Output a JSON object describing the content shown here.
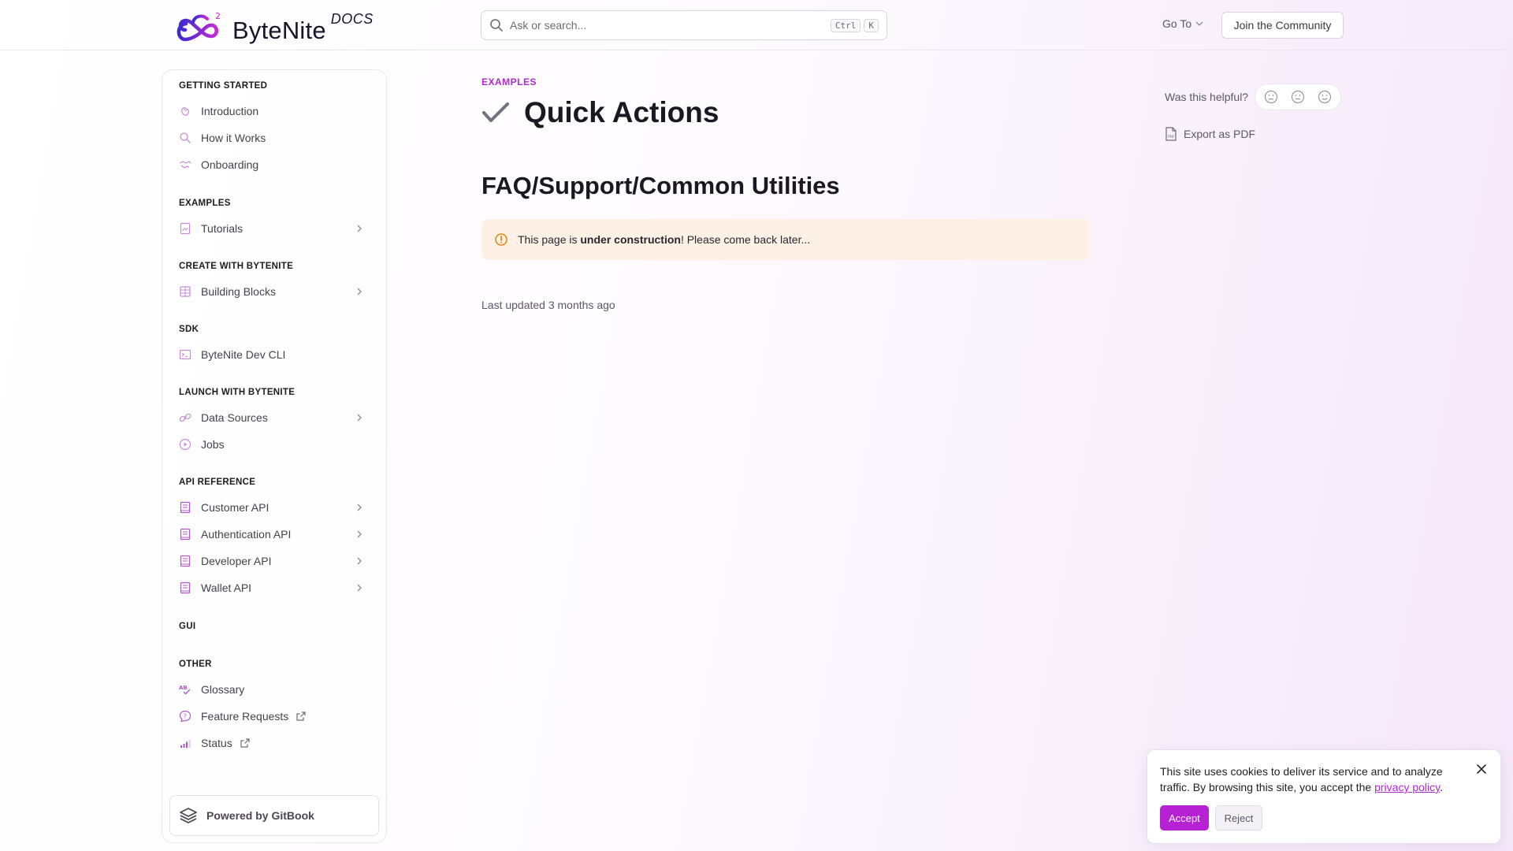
{
  "brand": {
    "name": "ByteNite",
    "suffix": "DOCS",
    "logo_sup": "2"
  },
  "search": {
    "placeholder": "Ask or search...",
    "key1": "Ctrl",
    "key2": "K"
  },
  "nav": {
    "goto": "Go To",
    "join": "Join the Community"
  },
  "sidebar": {
    "sections": [
      {
        "title": "GETTING STARTED",
        "items": [
          {
            "label": "Introduction",
            "icon": "hand-wave-icon"
          },
          {
            "label": "How it Works",
            "icon": "magnifier-icon"
          },
          {
            "label": "Onboarding",
            "icon": "handshake-icon"
          }
        ]
      },
      {
        "title": "EXAMPLES",
        "items": [
          {
            "label": "Tutorials",
            "icon": "book-image-icon",
            "expandable": true
          }
        ]
      },
      {
        "title": "CREATE WITH BYTENITE",
        "items": [
          {
            "label": "Building Blocks",
            "icon": "blocks-icon",
            "expandable": true
          }
        ]
      },
      {
        "title": "SDK",
        "items": [
          {
            "label": "ByteNite Dev CLI",
            "icon": "terminal-icon"
          }
        ]
      },
      {
        "title": "LAUNCH WITH BYTENITE",
        "items": [
          {
            "label": "Data Sources",
            "icon": "link-icon",
            "expandable": true
          },
          {
            "label": "Jobs",
            "icon": "play-circle-icon"
          }
        ]
      },
      {
        "title": "API REFERENCE",
        "items": [
          {
            "label": "Customer API",
            "icon": "book-icon",
            "expandable": true
          },
          {
            "label": "Authentication API",
            "icon": "book-icon",
            "expandable": true
          },
          {
            "label": "Developer API",
            "icon": "book-icon",
            "expandable": true
          },
          {
            "label": "Wallet API",
            "icon": "book-icon",
            "expandable": true
          }
        ]
      },
      {
        "title": "GUI",
        "items": []
      },
      {
        "title": "OTHER",
        "items": [
          {
            "label": "Glossary",
            "icon": "spellcheck-icon"
          },
          {
            "label": "Feature Requests",
            "icon": "message-question-icon",
            "external": true
          },
          {
            "label": "Status",
            "icon": "signal-bars-icon",
            "external": true
          }
        ]
      }
    ],
    "powered": "Powered by GitBook"
  },
  "page": {
    "breadcrumb": "EXAMPLES",
    "title": "Quick Actions",
    "heading": "FAQ/Support/Common Utilities",
    "notice_pre": "This page is ",
    "notice_bold": "under construction",
    "notice_post": "! Please come back later...",
    "updated": "Last updated 3 months ago"
  },
  "aside": {
    "helpful": "Was this helpful?",
    "export": "Export as PDF"
  },
  "cookie": {
    "text_pre": "This site uses cookies to deliver its service and to analyze traffic. By browsing this site, you accept the ",
    "link": "privacy policy",
    "text_post": ".",
    "accept": "Accept",
    "reject": "Reject"
  },
  "colors": {
    "accent": "#b622d3",
    "breadcrumb": "#b02ad0",
    "notice_bg": "#fdf1e6",
    "notice_icon": "#e8891a"
  }
}
